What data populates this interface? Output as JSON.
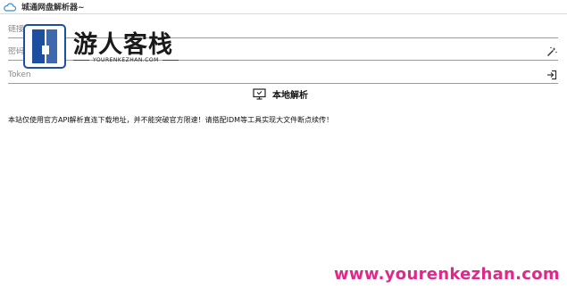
{
  "window": {
    "title": "城通网盘解析器~",
    "icon": "cloud-icon"
  },
  "form": {
    "link_placeholder": "链接或文件ID",
    "password_placeholder": "密码",
    "token_placeholder": "Token",
    "password_suffix_icon": "magic-wand-icon",
    "token_suffix_icon": "sign-in-icon"
  },
  "actions": {
    "local_parse_label": "本地解析",
    "local_parse_icon": "monitor-icon"
  },
  "notice": "本站仅使用官方API解析直连下载地址，并不能突破官方限速！请搭配IDM等工具实现大文件断点续传！",
  "watermark": {
    "logo_title": "游人客栈",
    "logo_subtitle": "YOURENKEZHAN.COM",
    "url": "www.yourenkezhan.com"
  },
  "colors": {
    "accent": "#e0288a",
    "underline": "#9c9c9c"
  }
}
